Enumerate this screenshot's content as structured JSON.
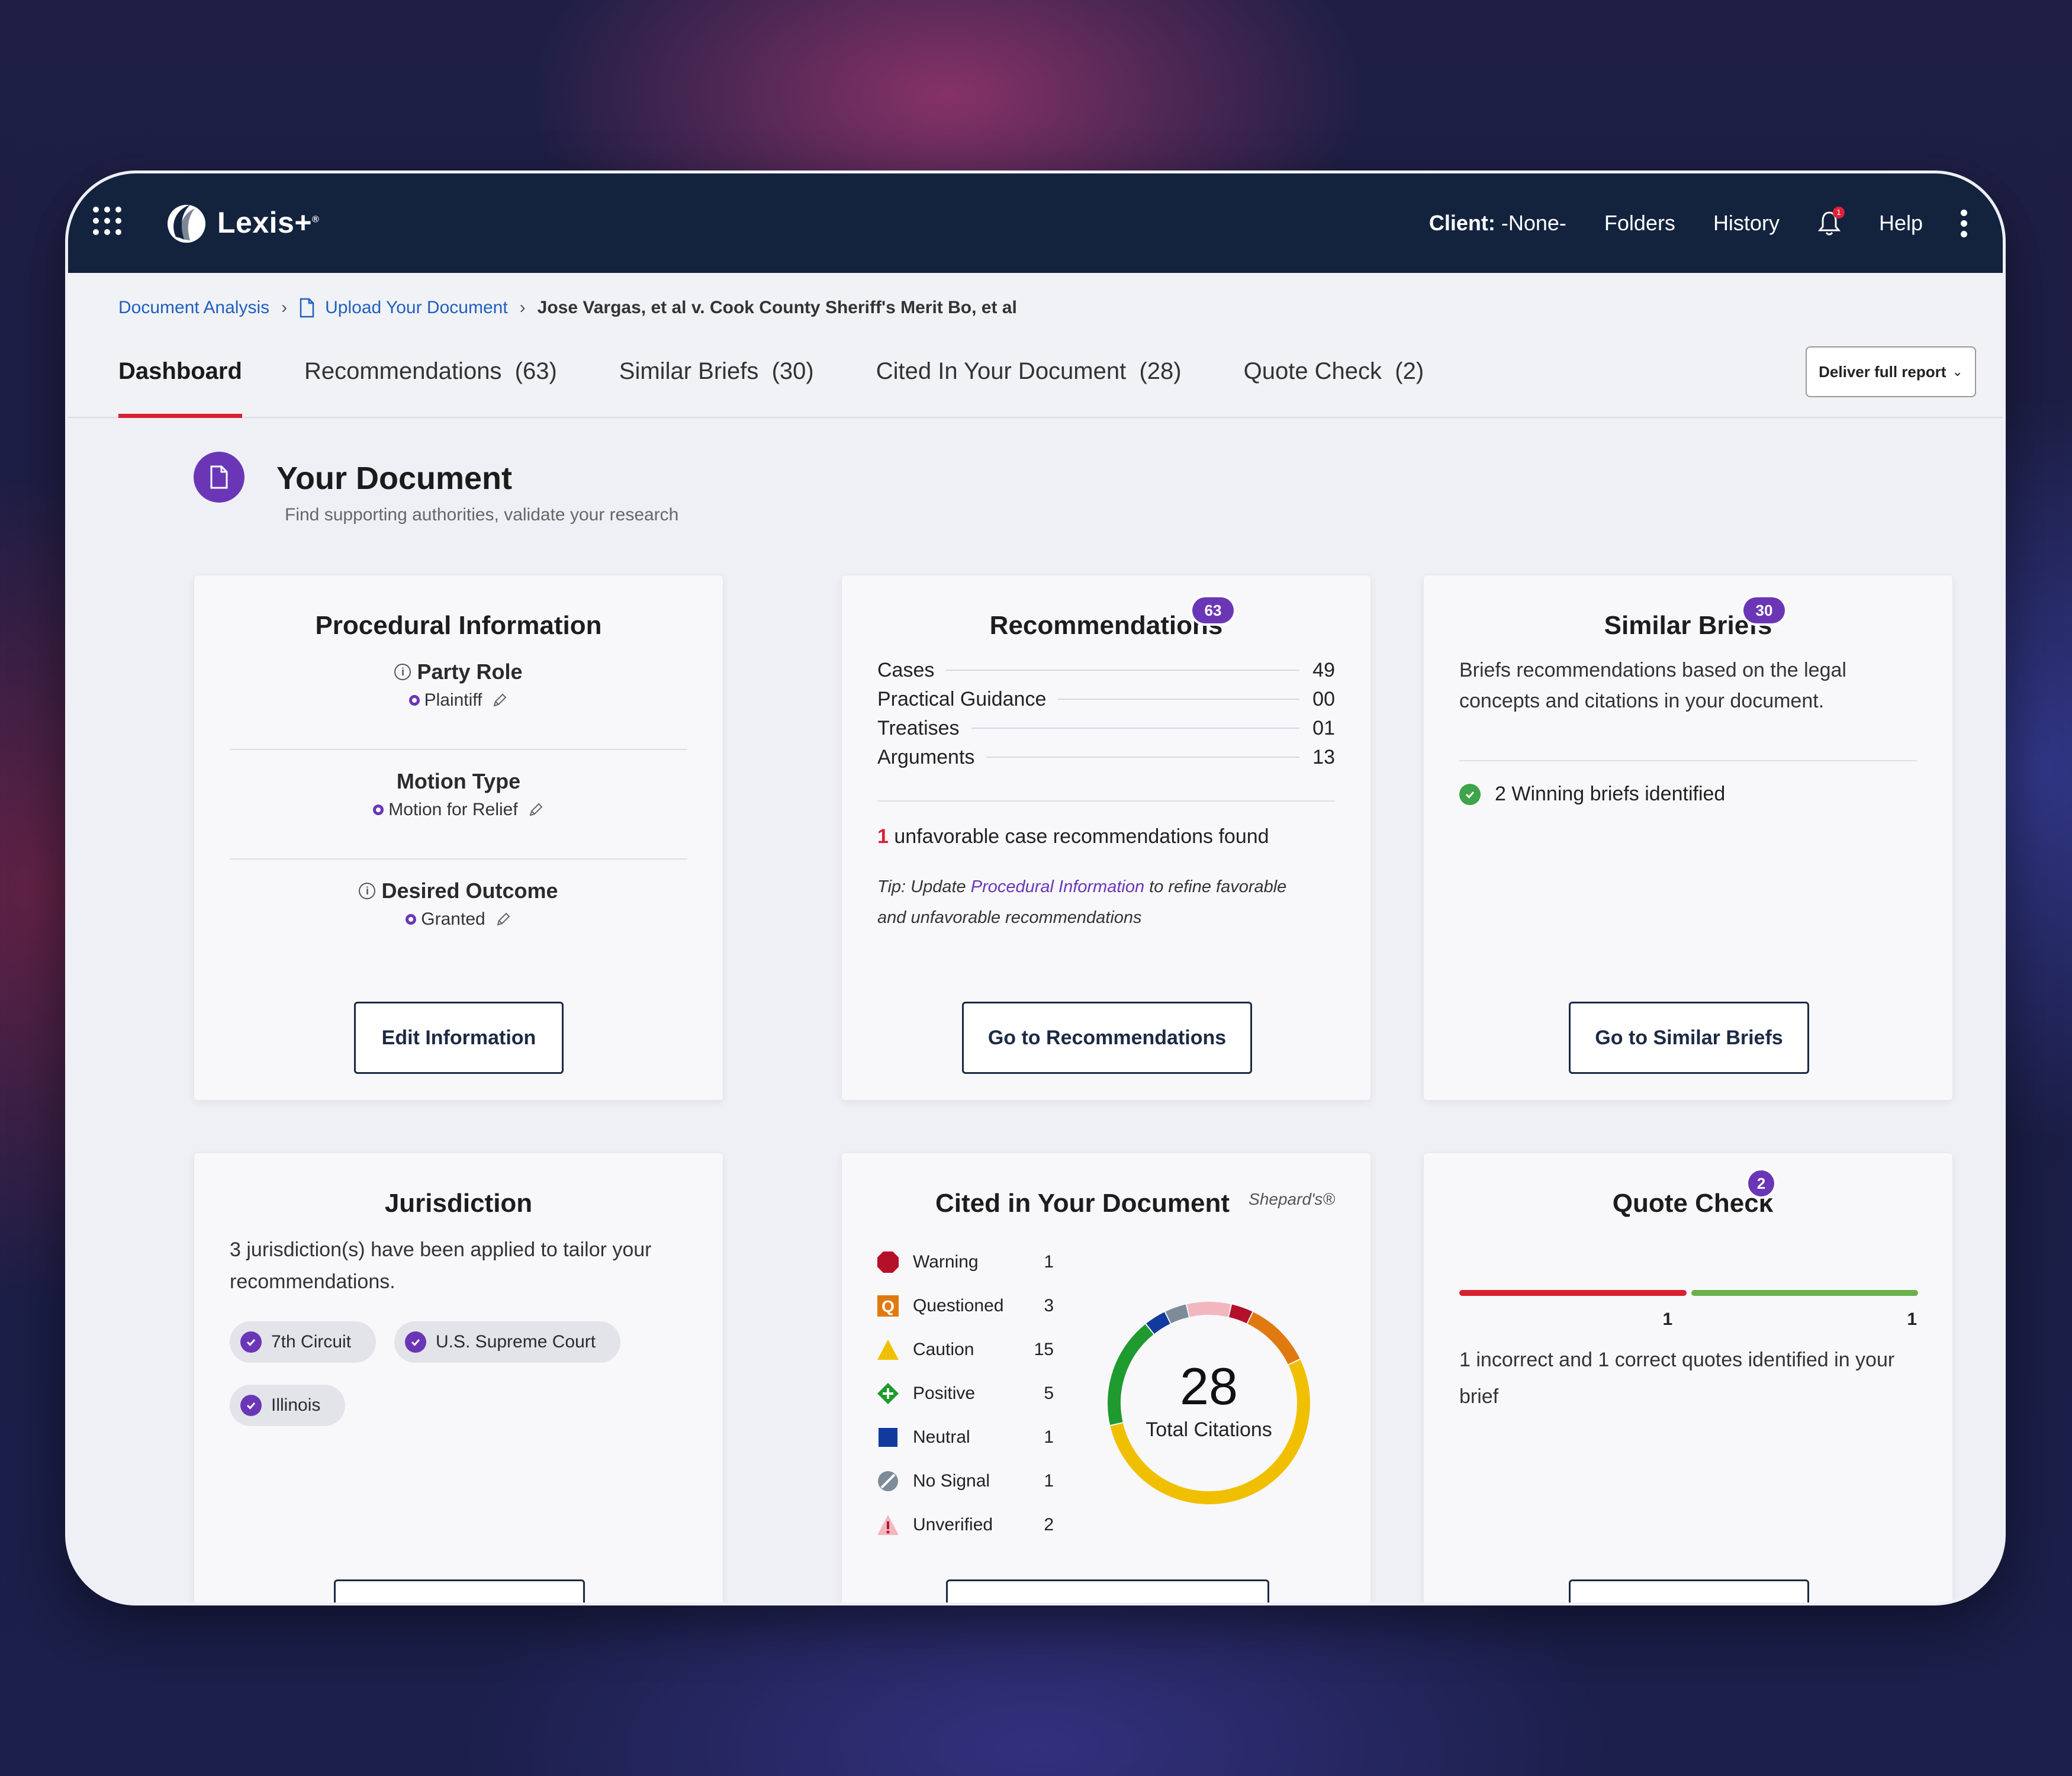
{
  "nav": {
    "brand": "Lexis+",
    "brand_mark": "®",
    "client_label": "Client:",
    "client_value": "-None-",
    "folders": "Folders",
    "history": "History",
    "notification_count": "1",
    "help": "Help"
  },
  "breadcrumb": {
    "item1": "Document Analysis",
    "item2": "Upload Your Document",
    "current": "Jose Vargas, et al v. Cook County Sheriff's Merit Bo, et al"
  },
  "tabs": [
    {
      "label": "Dashboard"
    },
    {
      "label": "Recommendations  (63)"
    },
    {
      "label": "Similar Briefs  (30)"
    },
    {
      "label": "Cited In Your Document  (28)"
    },
    {
      "label": "Quote Check  (2)"
    }
  ],
  "deliver_label": "Deliver full report",
  "page": {
    "title": "Your Document",
    "subtitle": "Find supporting authorities, validate your research"
  },
  "procedural": {
    "title": "Procedural Information",
    "party_role_label": "Party Role",
    "party_role_value": "Plaintiff",
    "motion_type_label": "Motion Type",
    "motion_type_value": "Motion for Relief",
    "desired_outcome_label": "Desired Outcome",
    "desired_outcome_value": "Granted",
    "button": "Edit Information"
  },
  "recommendations": {
    "title": "Recommendations",
    "badge": "63",
    "rows": [
      {
        "label": "Cases",
        "value": "49"
      },
      {
        "label": "Practical Guidance",
        "value": "00"
      },
      {
        "label": "Treatises",
        "value": "01"
      },
      {
        "label": "Arguments",
        "value": "13"
      }
    ],
    "unfavorable_count": "1",
    "unfavorable_text": "unfavorable case recommendations found",
    "tip_prefix": "Tip: Update",
    "tip_link": "Procedural Information",
    "tip_suffix": "to refine favorable",
    "tip_line2": "and unfavorable recommendations",
    "button": "Go to Recommendations"
  },
  "similar": {
    "title": "Similar Briefs",
    "badge": "30",
    "desc_line1": "Briefs recommendations based on the legal",
    "desc_line2": "concepts and citations in your document.",
    "winning": "2 Winning briefs identified",
    "button": "Go to Similar Briefs"
  },
  "jurisdiction": {
    "title": "Jurisdiction",
    "desc_line1": "3 jurisdiction(s) have been applied to tailor your",
    "desc_line2": "recommendations.",
    "chips": [
      "7th Circuit",
      "U.S. Supreme Court",
      "Illinois"
    ]
  },
  "cited": {
    "title": "Cited in Your Document",
    "provider": "Shepard's®",
    "total": "28",
    "total_label": "Total Citations",
    "legend": [
      {
        "label": "Warning",
        "count": 1,
        "color": "#b5102a"
      },
      {
        "label": "Questioned",
        "count": 3,
        "color": "#e07a10"
      },
      {
        "label": "Caution",
        "count": 15,
        "color": "#f0c000"
      },
      {
        "label": "Positive",
        "count": 5,
        "color": "#1f9a2f"
      },
      {
        "label": "Neutral",
        "count": 1,
        "color": "#123a9e"
      },
      {
        "label": "No Signal",
        "count": 1,
        "color": "#7e8b99"
      },
      {
        "label": "Unverified",
        "count": 2,
        "color": "#f2b7be"
      }
    ]
  },
  "quote": {
    "title": "Quote Check",
    "badge": "2",
    "incorrect": "1",
    "correct": "1",
    "incorrect_color": "#d8202f",
    "correct_color": "#6ab04c",
    "desc_line1": "1 incorrect and 1 correct quotes identified in your",
    "desc_line2": "brief"
  }
}
